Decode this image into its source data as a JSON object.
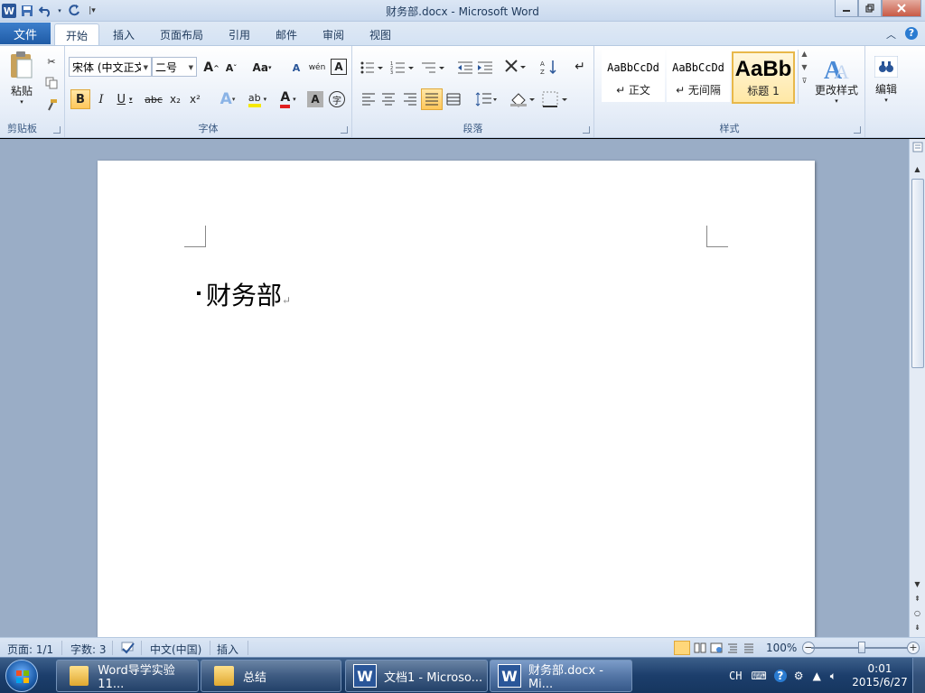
{
  "titlebar": {
    "title": "财务部.docx  -  Microsoft Word",
    "word_logo": "W",
    "qat_more": "|▾"
  },
  "tabs": {
    "file": "文件",
    "items": [
      "开始",
      "插入",
      "页面布局",
      "引用",
      "邮件",
      "审阅",
      "视图"
    ],
    "active": "开始"
  },
  "ribbon": {
    "clipboard": {
      "label": "剪贴板",
      "paste": "粘贴"
    },
    "font": {
      "label": "字体",
      "font_name": "宋体 (中文正文",
      "font_size": "二号",
      "bold": "B",
      "italic": "I",
      "underline": "U",
      "strike": "abc",
      "subscript": "x₂",
      "superscript": "x²",
      "grow": "A",
      "shrink": "A",
      "change_case": "Aa",
      "clear": "A",
      "phonetic": "wén",
      "border": "A",
      "text_effect": "A",
      "highlight": "ab",
      "font_color": "A",
      "shading": "A",
      "enclose": "字"
    },
    "paragraph": {
      "label": "段落"
    },
    "styles": {
      "label": "样式",
      "items": [
        {
          "sample": "AaBbCcDd",
          "name": "↵ 正文"
        },
        {
          "sample": "AaBbCcDd",
          "name": "↵ 无间隔"
        },
        {
          "sample": "AaBb",
          "name": "标题 1"
        }
      ],
      "change_styles": "更改样式"
    },
    "editing": {
      "label": "编辑"
    }
  },
  "document": {
    "heading": "财务部",
    "para_mark": "↵"
  },
  "statusbar": {
    "page": "页面: 1/1",
    "words": "字数: 3",
    "language": "中文(中国)",
    "mode": "插入",
    "zoom": "100%"
  },
  "taskbar": {
    "tasks": [
      {
        "label": "Word导学实验11..."
      },
      {
        "label": "总结"
      },
      {
        "label": "文档1 - Microso..."
      },
      {
        "label": "财务部.docx - Mi..."
      }
    ],
    "tray_lang": "CH",
    "time": "0:01",
    "date": "2015/6/27"
  },
  "colors": {
    "accent": "#2a5699",
    "file_tab": "#2e6ebd",
    "taskbar": "#1c3e6c",
    "workspace": "#9aadc6"
  }
}
